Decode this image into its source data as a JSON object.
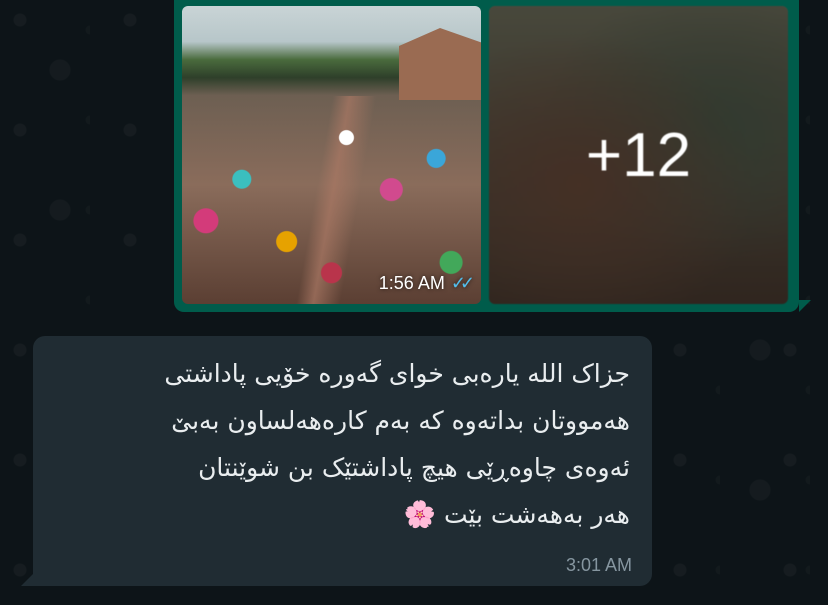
{
  "media_message": {
    "time": "1:56 AM",
    "status": "read",
    "status_icon": "double-check-icon",
    "status_color": "#53bdeb",
    "extra_count": "+12",
    "bubble_color": "#005c4b"
  },
  "text_message": {
    "lines": [
      "جزاک الله یارەبی خوای گەورە خۆیی پاداشتی",
      "هەمووتان بداتەوە کە بەم کارەهەلساون بەبێ",
      "ئەوەی چاوەڕێی هیچ پاداشتێک بن شوێنتان",
      "هەر بەهەشت بێت"
    ],
    "emoji": "🌸",
    "time": "3:01 AM",
    "bubble_color": "#202c33"
  }
}
